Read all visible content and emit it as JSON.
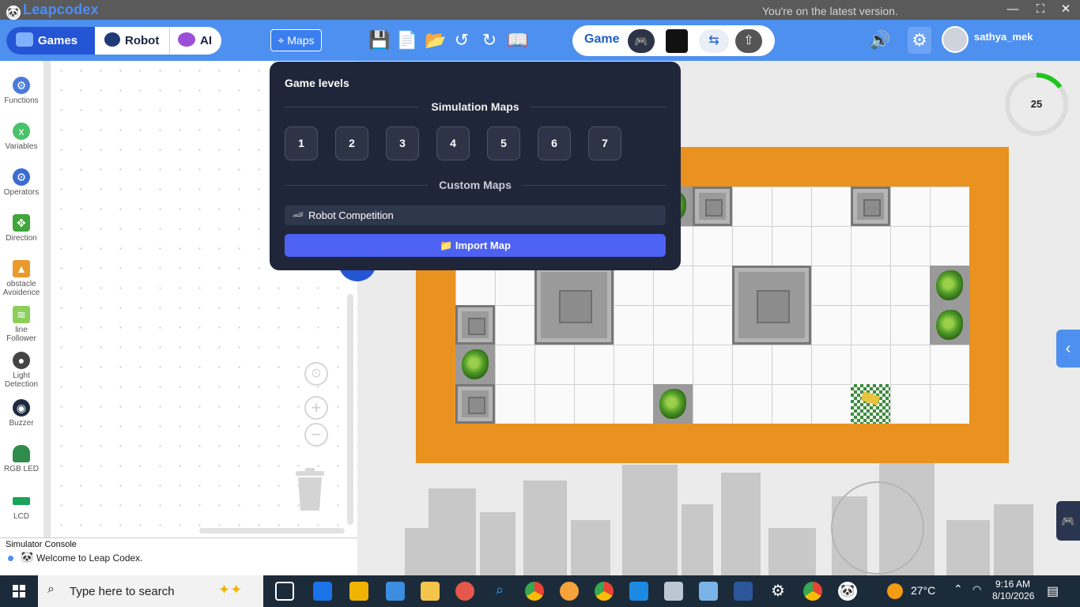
{
  "titlebar": {
    "app_title": "Leapcodex",
    "update_message": "You're on the latest version.",
    "minimize": "—",
    "maximize": "⛶",
    "close": "✕"
  },
  "toolbar": {
    "tabs": [
      {
        "label": "Games",
        "active": true
      },
      {
        "label": "Robot",
        "active": false
      },
      {
        "label": "AI",
        "active": false
      }
    ],
    "maps_label": "Maps",
    "mode_label": "Game",
    "user_name": "sathya_mek"
  },
  "sidebar": {
    "categories": [
      {
        "label": "Functions",
        "icon": "gear-icon",
        "color": "#4a7bd8"
      },
      {
        "label": "Variables",
        "icon": "variable-icon",
        "color": "#48c26a"
      },
      {
        "label": "Operators",
        "icon": "gear-icon",
        "color": "#3b6bd0"
      },
      {
        "label": "Direction",
        "icon": "move-icon",
        "color": "#3fa63a"
      },
      {
        "label": "obstacle Avoidence",
        "icon": "obstacle-icon",
        "color": "#e89b2a"
      },
      {
        "label": "line Follower",
        "icon": "line-follower-icon",
        "color": "#8bcf5a"
      },
      {
        "label": "Light Detection",
        "icon": "light-sensor-icon",
        "color": "#444444"
      },
      {
        "label": "Buzzer",
        "icon": "buzzer-icon",
        "color": "#1f2b40"
      },
      {
        "label": "RGB LED",
        "icon": "led-icon",
        "color": "#2f8c4d"
      },
      {
        "label": "LCD",
        "icon": "lcd-icon",
        "color": "#1aa35a"
      }
    ]
  },
  "console": {
    "title": "Simulator Console",
    "message": "Welcome to Leap Codex."
  },
  "maps_popup": {
    "title": "Game levels",
    "simulation_title": "Simulation Maps",
    "levels": [
      "1",
      "2",
      "3",
      "4",
      "5",
      "6",
      "7"
    ],
    "custom_title": "Custom Maps",
    "custom_maps": [
      "Robot Competition"
    ],
    "import_label": "Import Map",
    "import_icon": "📁"
  },
  "simulator": {
    "timer_value": "25",
    "timer_fraction": 0.15,
    "grid_cols": 13,
    "grid_rows": 6
  },
  "taskbar": {
    "search_placeholder": "Type here to search",
    "temperature": "27°C",
    "time": "9:16 AM",
    "date": "8/10/2026"
  },
  "colors": {
    "accent": "#4d90ef",
    "popup_bg": "#1f2639",
    "import_button": "#4d61f2",
    "board_border": "#e9921f"
  }
}
